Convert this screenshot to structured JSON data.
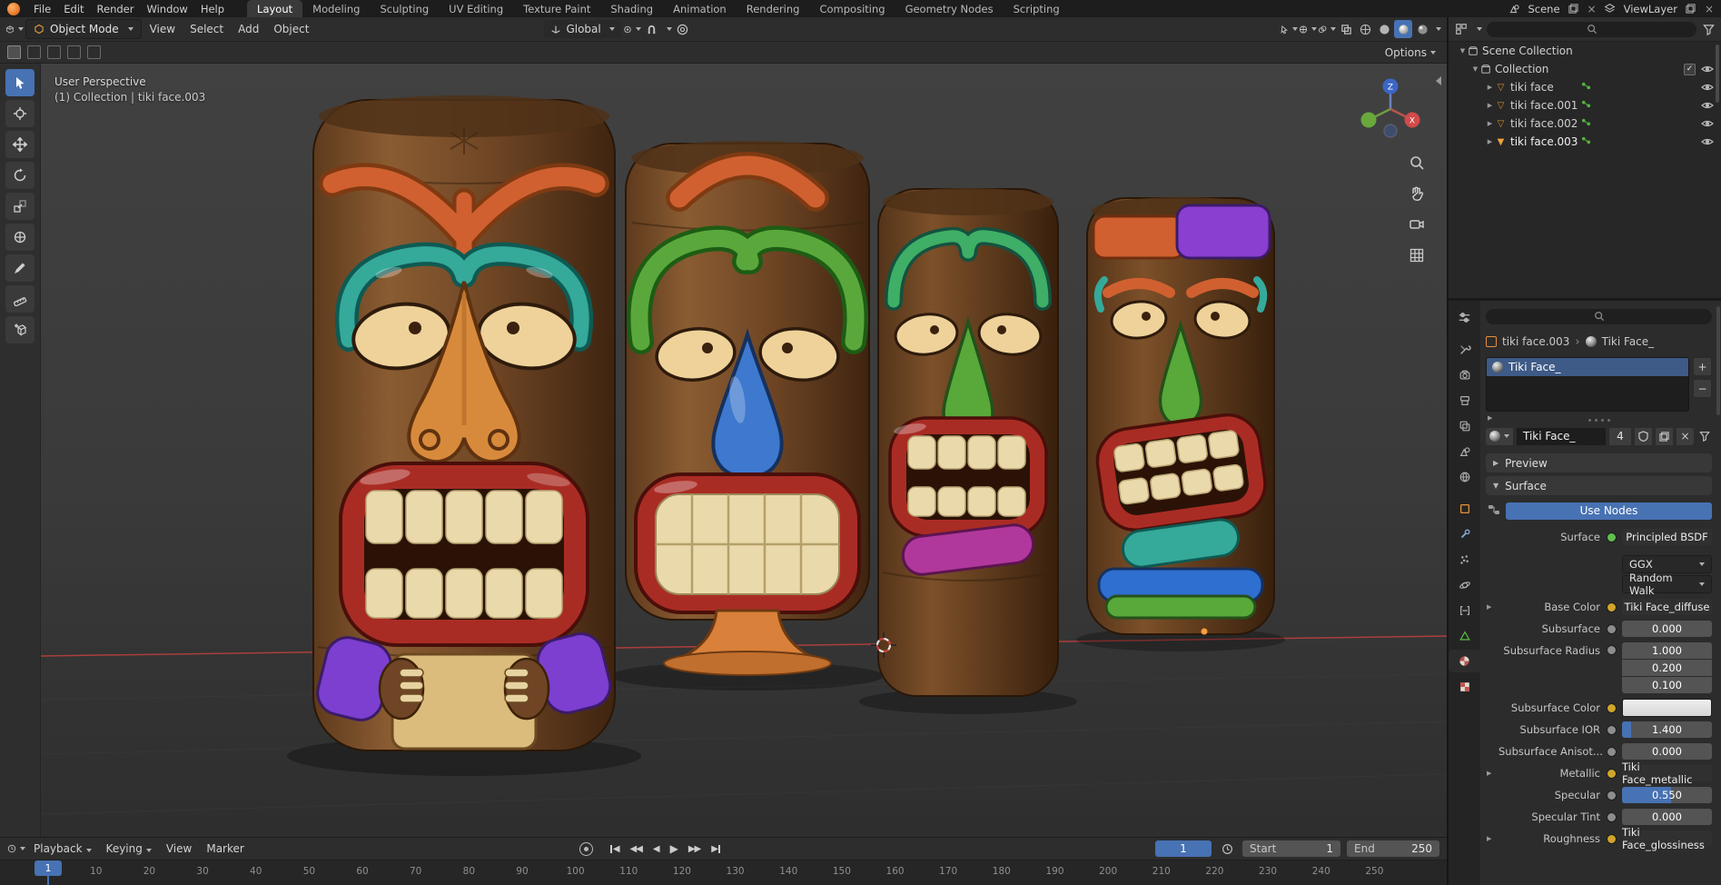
{
  "topbar": {
    "menus": [
      "File",
      "Edit",
      "Render",
      "Window",
      "Help"
    ],
    "workspaces": [
      "Layout",
      "Modeling",
      "Sculpting",
      "UV Editing",
      "Texture Paint",
      "Shading",
      "Animation",
      "Rendering",
      "Compositing",
      "Geometry Nodes",
      "Scripting"
    ],
    "scene_name": "Scene",
    "view_layer_name": "ViewLayer"
  },
  "viewport_header": {
    "mode": "Object Mode",
    "view": "View",
    "select": "Select",
    "add": "Add",
    "object": "Object",
    "orientation": "Global",
    "options": "Options"
  },
  "viewport": {
    "perspective_label": "User Perspective",
    "context_label": "(1) Collection | tiki face.003",
    "axis_z": "Z",
    "axis_x": "X"
  },
  "outliner": {
    "root_label": "Scene Collection",
    "collection_label": "Collection",
    "objects": [
      "tiki face",
      "tiki face.001",
      "tiki face.002",
      "tiki face.003"
    ]
  },
  "properties": {
    "breadcrumb_object": "tiki face.003",
    "breadcrumb_material": "Tiki Face_",
    "slot_material": "Tiki Face_",
    "material_name": "Tiki Face_",
    "users_count": "4",
    "preview_label": "Preview",
    "surface_section_label": "Surface",
    "use_nodes_label": "Use Nodes",
    "surface_label": "Surface",
    "surface_value": "Principled BSDF",
    "distribution_value": "GGX",
    "subsurface_method_value": "Random Walk",
    "base_color_label": "Base Color",
    "base_color_value": "Tiki Face_diffuse",
    "subsurface_label": "Subsurface",
    "subsurface_value": "0.000",
    "subsurface_radius_label": "Subsurface Radius",
    "subsurface_radius_values": [
      "1.000",
      "0.200",
      "0.100"
    ],
    "subsurface_color_label": "Subsurface Color",
    "subsurface_ior_label": "Subsurface IOR",
    "subsurface_ior_value": "1.400",
    "subsurface_aniso_label": "Subsurface Anisot...",
    "subsurface_aniso_value": "0.000",
    "metallic_label": "Metallic",
    "metallic_value": "Tiki Face_metallic",
    "specular_label": "Specular",
    "specular_value": "0.550",
    "specular_tint_label": "Specular Tint",
    "specular_tint_value": "0.000",
    "roughness_label": "Roughness",
    "roughness_value": "Tiki Face_glossiness"
  },
  "timeline": {
    "playback": "Playback",
    "keying": "Keying",
    "view": "View",
    "marker": "Marker",
    "current_frame": "1",
    "start_label": "Start",
    "start_value": "1",
    "end_label": "End",
    "end_value": "250",
    "playhead_frame": "1",
    "ticks": [
      10,
      20,
      30,
      40,
      50,
      60,
      70,
      80,
      90,
      100,
      110,
      120,
      130,
      140,
      150,
      160,
      170,
      180,
      190,
      200,
      210,
      220,
      230,
      240,
      250
    ]
  }
}
